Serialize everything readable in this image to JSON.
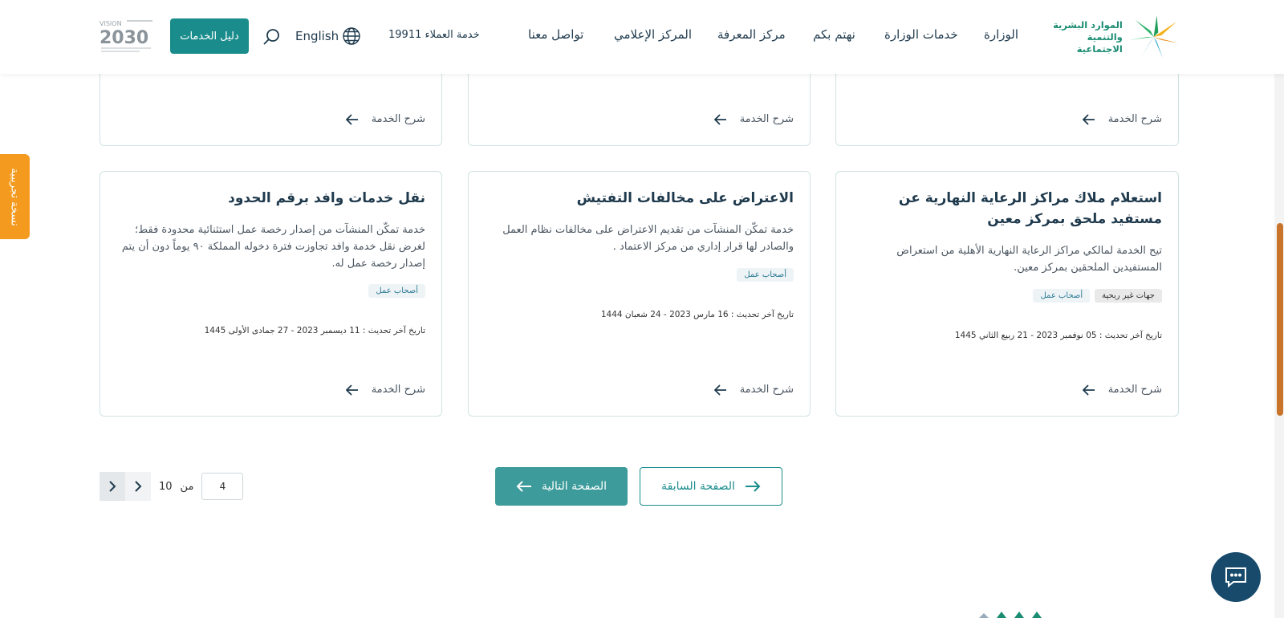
{
  "header": {
    "logo_text_line1": "الموارد البشرية",
    "logo_text_line2": "والتنمية الاجتماعية",
    "nav": [
      "الوزارة",
      "خدمات الوزارة",
      "نهتم بكم",
      "مركز المعرفة",
      "المركز الإعلامي",
      "تواصل معنا"
    ],
    "hotline": "خدمة العملاء 19911",
    "language": "English",
    "guide_button": "دليل الخدمات",
    "vision_label": "VISION",
    "vision_year": "2030"
  },
  "beta_tab": "نسخة تجريبية",
  "cards_top": [
    {
      "explain": "شرح الخدمة"
    },
    {
      "explain": "شرح الخدمة"
    },
    {
      "explain": "شرح الخدمة"
    }
  ],
  "cards": [
    {
      "title": "استعلام ملاك مراكز الرعاية النهارية عن مستفيد ملحق بمركز معين",
      "description": "تيح الخدمة لمالكي مراكز الرعاية النهارية الأهلية من استعراض المستفيدين الملحقين بمركز معين.",
      "tags": [
        "جهات غير ربحية",
        "أصحاب عمل"
      ],
      "updated": "تاريخ آخر تحديث : 05 نوفمبر 2023 - 21 ربيع الثاني 1445",
      "explain": "شرح الخدمة"
    },
    {
      "title": "الاعتراض على مخالفات التفتيش",
      "description": "خدمة تمكّن المنشآت من تقديم الاعتراض على مخالفات نظام العمل والصادر لها قرار إداري من مركز الاعتماد .",
      "tags": [
        "أصحاب عمل"
      ],
      "updated": "تاريخ آخر تحديث : 16 مارس 2023 - 24 شعبان 1444",
      "explain": "شرح الخدمة"
    },
    {
      "title": "نقل خدمات وافد برقم الحدود",
      "description": "خدمة تمكّن المنشآت من إصدار رخصة عمل استثنائية محدودة فقط؛ لغرض نقل خدمة وافد تجاوزت فترة دخوله المملكة ٩٠ يوماً دون أن يتم إصدار رخصة عمل له.",
      "tags": [
        "أصحاب عمل"
      ],
      "updated": "تاريخ آخر تحديث : 11 ديسمبر 2023 - 27 جمادى الأولى 1445",
      "explain": "شرح الخدمة"
    }
  ],
  "pagination": {
    "prev_label": "الصفحة السابقة",
    "next_label": "الصفحة التالية",
    "current_page": "4",
    "of_label": "من",
    "total_pages": "10"
  },
  "colors": {
    "primary": "#1a8c8c",
    "accent": "#f49a1e",
    "text": "#1f3a4d",
    "chat": "#174a6b"
  }
}
